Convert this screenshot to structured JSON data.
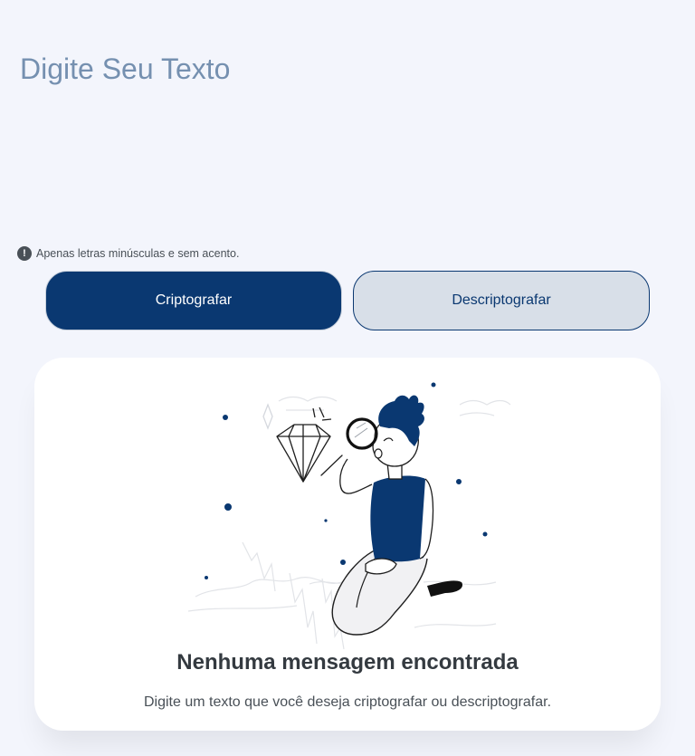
{
  "input": {
    "placeholder": "Digite Seu Texto",
    "value": ""
  },
  "hint": {
    "icon": "exclamation-icon",
    "text": "Apenas letras minúsculas e sem acento."
  },
  "buttons": {
    "encrypt_label": "Criptografar",
    "decrypt_label": "Descriptografar"
  },
  "result": {
    "illustration": "person-magnifier-diamond-illustration",
    "title": "Nenhuma mensagem encontrada",
    "subtitle": "Digite um texto que você deseja criptografar ou descriptografar."
  },
  "colors": {
    "brand": "#0A3871",
    "background": "#F3F5FC",
    "placeholder": "#7590B0",
    "secondary_button": "#D8DFE8",
    "text_dark": "#343A40",
    "text_muted": "#495057"
  }
}
